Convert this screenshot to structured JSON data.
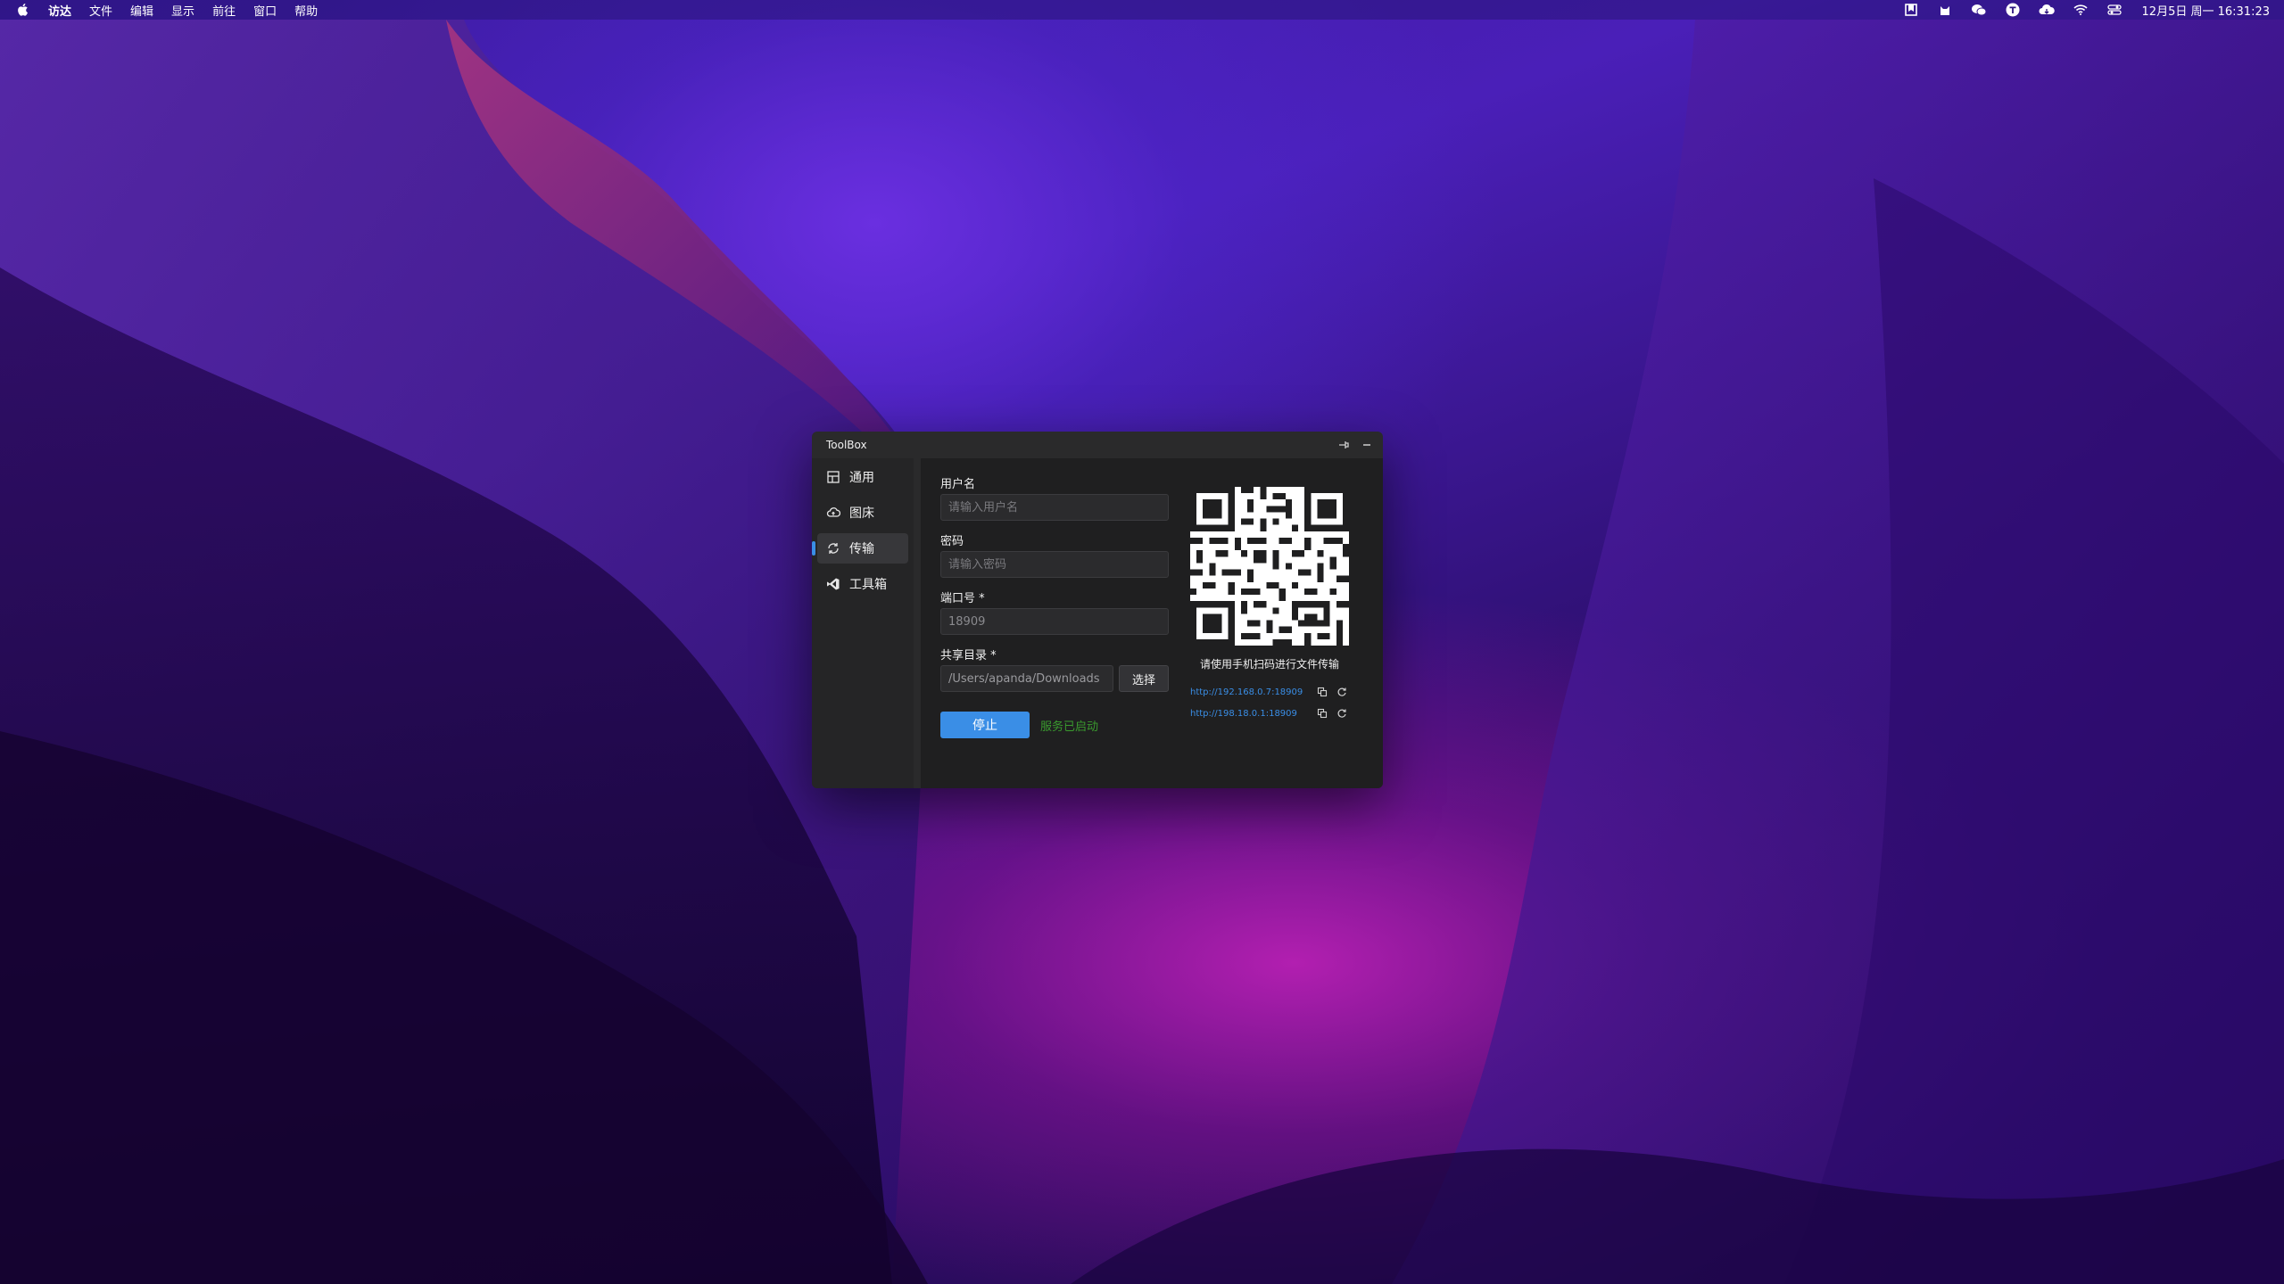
{
  "menubar": {
    "items": [
      "访达",
      "文件",
      "编辑",
      "显示",
      "前往",
      "窗口",
      "帮助"
    ],
    "clock": "12月5日 周一 16:31:23"
  },
  "window": {
    "title": "ToolBox",
    "nav": [
      {
        "label": "通用",
        "icon": "layout-icon"
      },
      {
        "label": "图床",
        "icon": "cloud-icon"
      },
      {
        "label": "传输",
        "icon": "transfer-icon",
        "active": true
      },
      {
        "label": "工具箱",
        "icon": "vscode-icon"
      }
    ],
    "form": {
      "username_label": "用户名",
      "username_placeholder": "请输入用户名",
      "password_label": "密码",
      "password_placeholder": "请输入密码",
      "port_label": "端口号 *",
      "port_value": "18909",
      "dir_label": "共享目录 *",
      "dir_value": "/Users/apanda/Downloads",
      "select_label": "选择",
      "stop_label": "停止",
      "status_text": "服务已启动"
    },
    "qr": {
      "caption": "请使用手机扫码进行文件传输",
      "urls": [
        "http://192.168.0.7:18909",
        "http://198.18.0.1:18909"
      ]
    }
  },
  "colors": {
    "accent": "#3a8ee6",
    "status_green": "#3a9a2e",
    "window_bg": "#2a2a2b"
  }
}
